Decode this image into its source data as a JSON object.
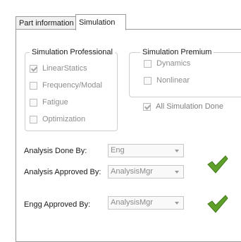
{
  "tabs": [
    {
      "label": "Part information",
      "active": false
    },
    {
      "label": "Simulation",
      "active": true
    }
  ],
  "simulation_professional": {
    "title": "Simulation Professional",
    "items": [
      {
        "label": "LinearStatics",
        "checked": true
      },
      {
        "label": "Frequency/Modal",
        "checked": false
      },
      {
        "label": "Fatigue",
        "checked": false
      },
      {
        "label": "Optimization",
        "checked": false
      }
    ]
  },
  "simulation_premium": {
    "title": "Simulation Premium",
    "items": [
      {
        "label": "Dynamics",
        "checked": false
      },
      {
        "label": "Nonlinear",
        "checked": false
      }
    ]
  },
  "all_done": {
    "label": "All Simulation Done",
    "checked": true
  },
  "form": {
    "analysis_done_by": {
      "label": "Analysis Done By:",
      "value": "Eng"
    },
    "analysis_approved_by": {
      "label": "Analysis Approved By:",
      "value": "AnalysisMgr",
      "approved": true
    },
    "engg_approved_by": {
      "label": "Engg Approved By:",
      "value": "AnalysisMgr",
      "approved": true
    }
  },
  "colors": {
    "check_green": "#5fa02a",
    "check_green_dark": "#3f7a17"
  },
  "icons": {
    "approval": "green-checkmark-icon",
    "dropdown": "chevron-down-icon"
  }
}
